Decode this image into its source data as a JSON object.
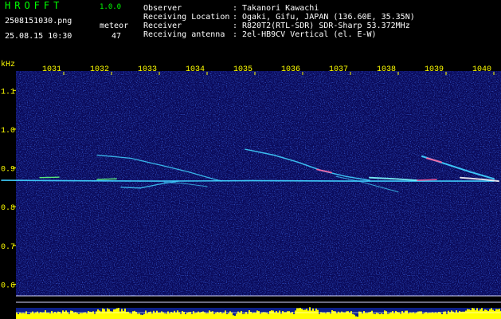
{
  "app": {
    "title": "HROFFT",
    "version": "1.0.0",
    "file_name": "2508151030.png",
    "datetime": "25.08.15 10:30",
    "meteor_label": "meteor",
    "meteor_count": "47"
  },
  "info": {
    "rows": [
      {
        "key": "Observer",
        "sep": ":",
        "value": "Takanori Kawachi"
      },
      {
        "key": "Receiving Location",
        "sep": ":",
        "value": "Ogaki, Gifu, JAPAN (136.60E, 35.35N)"
      },
      {
        "key": "Receiver",
        "sep": ":",
        "value": "R820T2(RTL-SDR) SDR-Sharp 53.372MHz"
      },
      {
        "key": "Receiving antenna",
        "sep": ":",
        "value": "2el-HB9CV Vertical (el. E-W)"
      }
    ]
  },
  "chart_data": {
    "type": "heatmap",
    "ylabel": "kHz",
    "x_ticks": [
      "1031",
      "1032",
      "1033",
      "1034",
      "1035",
      "1036",
      "1037",
      "1038",
      "1039",
      "1040"
    ],
    "y_ticks": [
      "1.1",
      "1.0",
      "0.9",
      "0.8",
      "0.7",
      "0.6"
    ],
    "x_range": [
      1030,
      1040
    ],
    "y_range": [
      0.57,
      1.15
    ],
    "colors": {
      "background": "#0a0a5a",
      "noise": "#1c3cd8",
      "trace": "#40d0ff",
      "strong": "#ff60a0",
      "axis_text": "#ffff00",
      "header_text": "#00ff00",
      "level_bar": "#ffff00"
    }
  }
}
